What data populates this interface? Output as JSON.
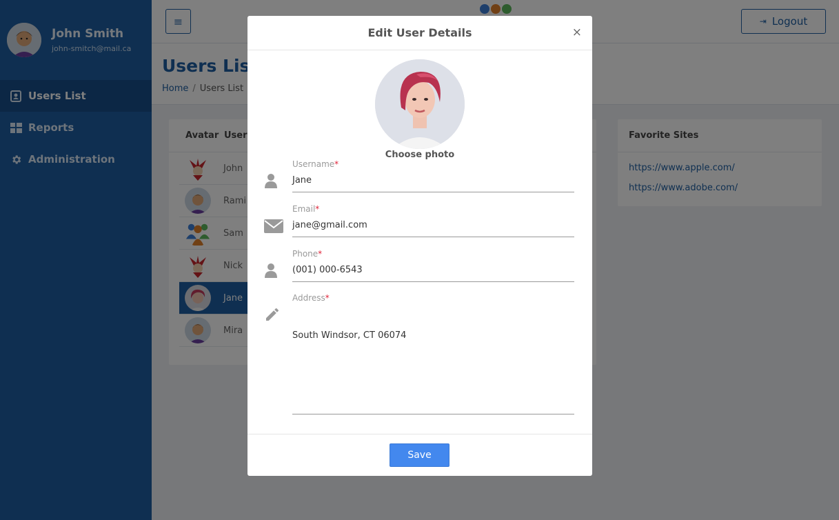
{
  "sidebar": {
    "profile": {
      "name": "John Smith",
      "email": "john-smitch@mail.ca"
    },
    "items": [
      {
        "label": "Users List",
        "icon": "contacts-icon",
        "active": true
      },
      {
        "label": "Reports",
        "icon": "dashboard-icon",
        "active": false
      },
      {
        "label": "Administration",
        "icon": "gear-icon",
        "active": false
      }
    ]
  },
  "topbar": {
    "logout_label": "Logout"
  },
  "page": {
    "title": "Users List",
    "breadcrumb": {
      "home": "Home",
      "sep": "/",
      "current": "Users List"
    }
  },
  "users_table": {
    "columns": [
      "Avatar",
      "Userr"
    ],
    "rows": [
      {
        "username": "John",
        "avatar": "jester-avatar"
      },
      {
        "username": "Rami",
        "avatar": "man-avatar"
      },
      {
        "username": "Sam",
        "avatar": "group-avatar"
      },
      {
        "username": "Nick",
        "avatar": "jester-avatar"
      },
      {
        "username": "Jane",
        "avatar": "woman-avatar",
        "selected": true
      },
      {
        "username": "Mira",
        "avatar": "man-avatar"
      }
    ]
  },
  "favorites": {
    "title": "Favorite Sites",
    "links": [
      "https://www.apple.com/",
      "https://www.adobe.com/"
    ]
  },
  "modal": {
    "title": "Edit User Details",
    "close": "×",
    "choose_photo": "Choose photo",
    "fields": {
      "username": {
        "label": "Username",
        "value": "Jane"
      },
      "email": {
        "label": "Email",
        "value": "jane@gmail.com"
      },
      "phone": {
        "label": "Phone",
        "value": "(001) 000-6543"
      },
      "address": {
        "label": "Address",
        "value": "South Windsor, CT 06074"
      }
    },
    "required_mark": "*",
    "save_label": "Save"
  },
  "colors": {
    "brand": "#1e5fa2",
    "save": "#4388ee",
    "required": "#e0243a"
  }
}
